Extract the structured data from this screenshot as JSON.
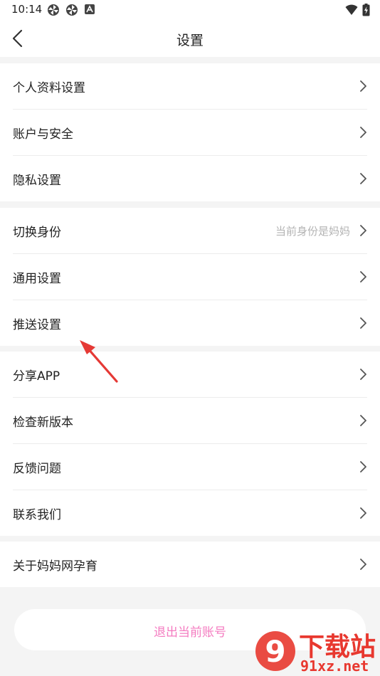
{
  "status_bar": {
    "time": "10:14",
    "left_icons": [
      "pinwheel-icon",
      "pinwheel-icon",
      "a-box-icon"
    ],
    "right_icons": [
      "wifi-icon",
      "battery-icon"
    ]
  },
  "nav": {
    "title": "设置",
    "back_icon": "chevron-left-icon"
  },
  "groups": [
    {
      "items": [
        {
          "label": "个人资料设置"
        },
        {
          "label": "账户与安全"
        },
        {
          "label": "隐私设置"
        }
      ]
    },
    {
      "items": [
        {
          "label": "切换身份",
          "value": "当前身份是妈妈"
        },
        {
          "label": "通用设置"
        },
        {
          "label": "推送设置"
        }
      ]
    },
    {
      "items": [
        {
          "label": "分享APP"
        },
        {
          "label": "检查新版本"
        },
        {
          "label": "反馈问题"
        },
        {
          "label": "联系我们"
        }
      ]
    },
    {
      "items": [
        {
          "label": "关于妈妈网孕育"
        }
      ]
    }
  ],
  "logout": {
    "label": "退出当前账号"
  },
  "colors": {
    "accent": "#f47bc0",
    "background": "#f4f4f4",
    "annotation_arrow": "#e53935",
    "watermark": "#e8382f"
  },
  "watermark": {
    "main": "下载站",
    "sub": "91xz.net",
    "logo_glyph": "9"
  }
}
